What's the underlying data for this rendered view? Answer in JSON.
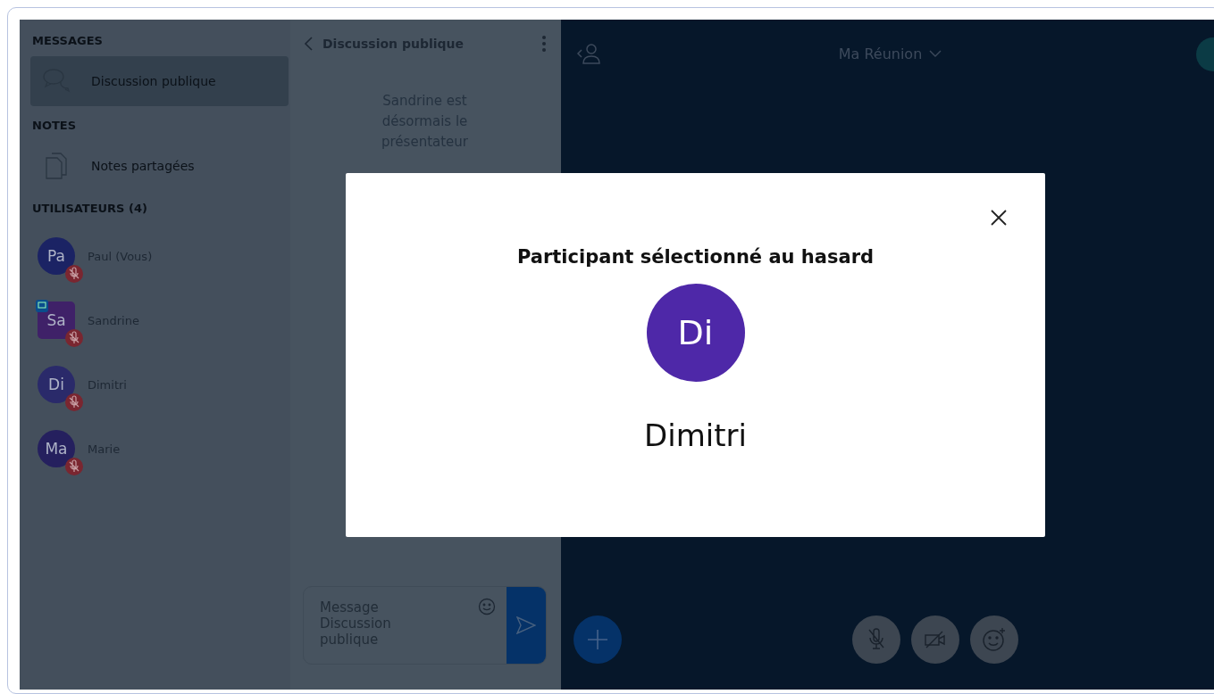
{
  "sidebar": {
    "messages_title": "MESSAGES",
    "messages": [
      {
        "label": "Discussion publique",
        "selected": true
      }
    ],
    "notes_title": "NOTES",
    "notes": [
      {
        "label": "Notes partagées",
        "selected": false
      }
    ],
    "users_title": "UTILISATEURS (4)",
    "users": [
      {
        "initials": "Pa",
        "name": "Paul (Vous)",
        "color": "#1b2364",
        "presenter": false,
        "muted": true
      },
      {
        "initials": "Sa",
        "name": "Sandrine",
        "color": "#3f2168",
        "presenter": true,
        "muted": true
      },
      {
        "initials": "Di",
        "name": "Dimitri",
        "color": "#2a2a6a",
        "presenter": false,
        "muted": true
      },
      {
        "initials": "Ma",
        "name": "Marie",
        "color": "#25205e",
        "presenter": false,
        "muted": true
      }
    ]
  },
  "chat": {
    "title": "Discussion publique",
    "system_message": "Sandrine est désormais le présentateur",
    "input": {
      "placeholder": "Message Discussion publique"
    }
  },
  "main": {
    "title": "Ma Réunion"
  },
  "modal": {
    "title": "Participant sélectionné au hasard",
    "initials": "Di",
    "name": "Dimitri"
  }
}
